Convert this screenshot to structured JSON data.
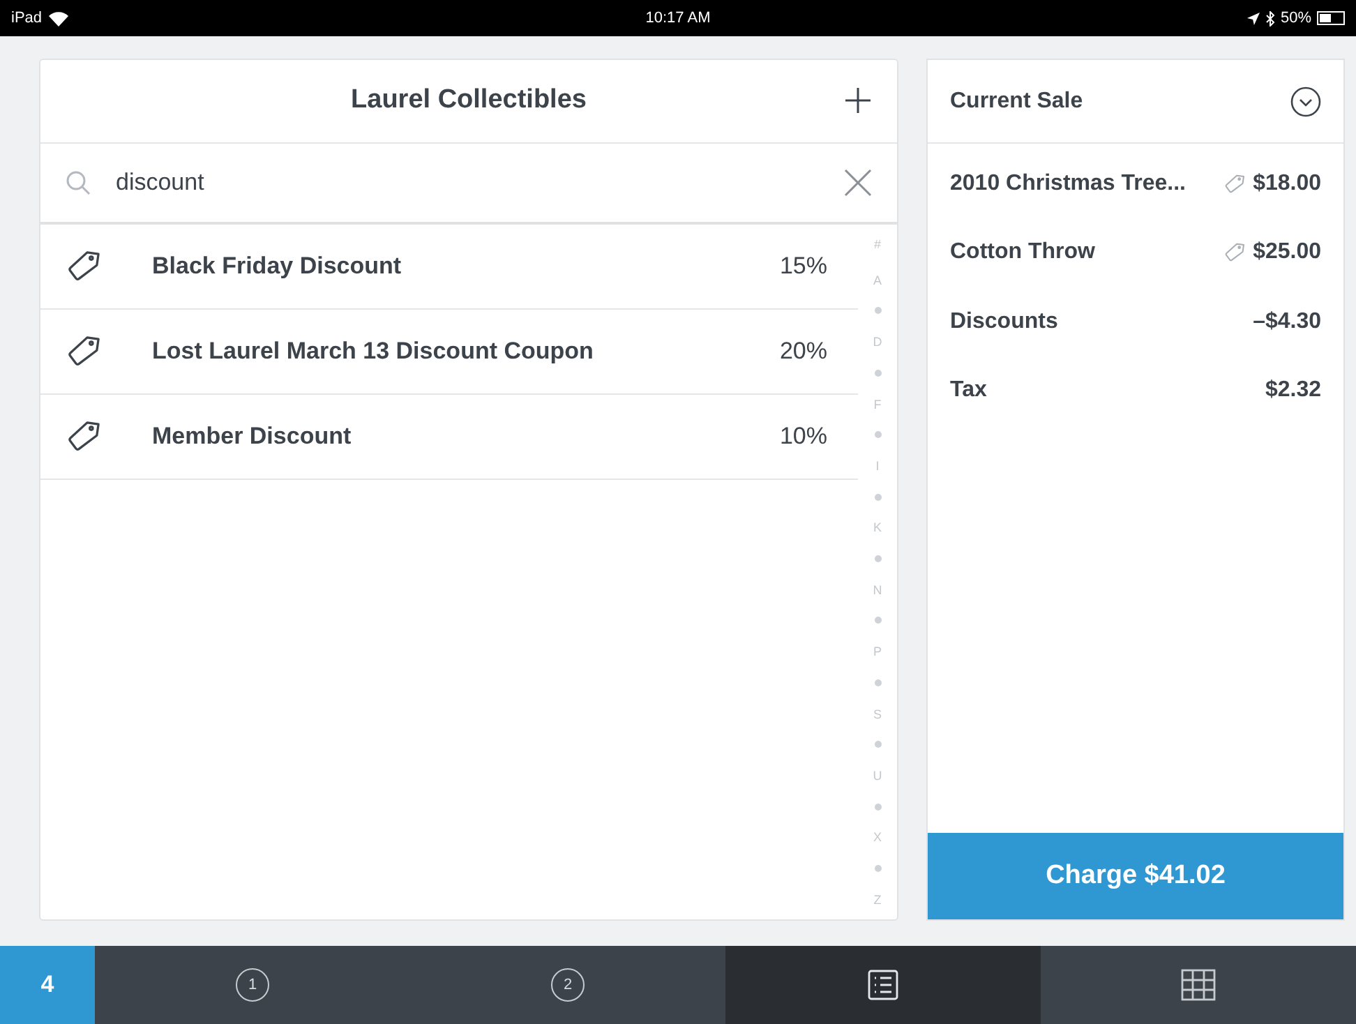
{
  "status_bar": {
    "device": "iPad",
    "time": "10:17 AM",
    "battery": "50%"
  },
  "library": {
    "title": "Laurel Collectibles",
    "search": {
      "value": "discount"
    },
    "items": [
      {
        "name": "Black Friday Discount",
        "amount": "15%"
      },
      {
        "name": "Lost Laurel March 13 Discount Coupon",
        "amount": "20%"
      },
      {
        "name": "Member Discount",
        "amount": "10%"
      }
    ],
    "index": [
      {
        "kind": "letter",
        "label": "#"
      },
      {
        "kind": "letter",
        "label": "A"
      },
      {
        "kind": "dot"
      },
      {
        "kind": "letter",
        "label": "D"
      },
      {
        "kind": "dot"
      },
      {
        "kind": "letter",
        "label": "F"
      },
      {
        "kind": "dot"
      },
      {
        "kind": "letter",
        "label": "I"
      },
      {
        "kind": "dot"
      },
      {
        "kind": "letter",
        "label": "K"
      },
      {
        "kind": "dot"
      },
      {
        "kind": "letter",
        "label": "N"
      },
      {
        "kind": "dot"
      },
      {
        "kind": "letter",
        "label": "P"
      },
      {
        "kind": "dot"
      },
      {
        "kind": "letter",
        "label": "S"
      },
      {
        "kind": "dot"
      },
      {
        "kind": "letter",
        "label": "U"
      },
      {
        "kind": "dot"
      },
      {
        "kind": "letter",
        "label": "X"
      },
      {
        "kind": "dot"
      },
      {
        "kind": "letter",
        "label": "Z"
      }
    ]
  },
  "sale": {
    "title": "Current Sale",
    "lines": [
      {
        "label": "2010 Christmas Tree...",
        "amount": "$18.00",
        "tagged": true
      },
      {
        "label": "Cotton Throw",
        "amount": "$25.00",
        "tagged": true
      },
      {
        "label": "Discounts",
        "amount": "–$4.30",
        "tagged": false
      },
      {
        "label": "Tax",
        "amount": "$2.32",
        "tagged": false
      }
    ],
    "charge_button": "Charge $41.02"
  },
  "tab_bar": {
    "badge": "4",
    "tabs": [
      {
        "kind": "number",
        "label": "1",
        "selected": false
      },
      {
        "kind": "number",
        "label": "2",
        "selected": false
      },
      {
        "kind": "list",
        "selected": true
      },
      {
        "kind": "grid",
        "selected": false
      }
    ]
  }
}
